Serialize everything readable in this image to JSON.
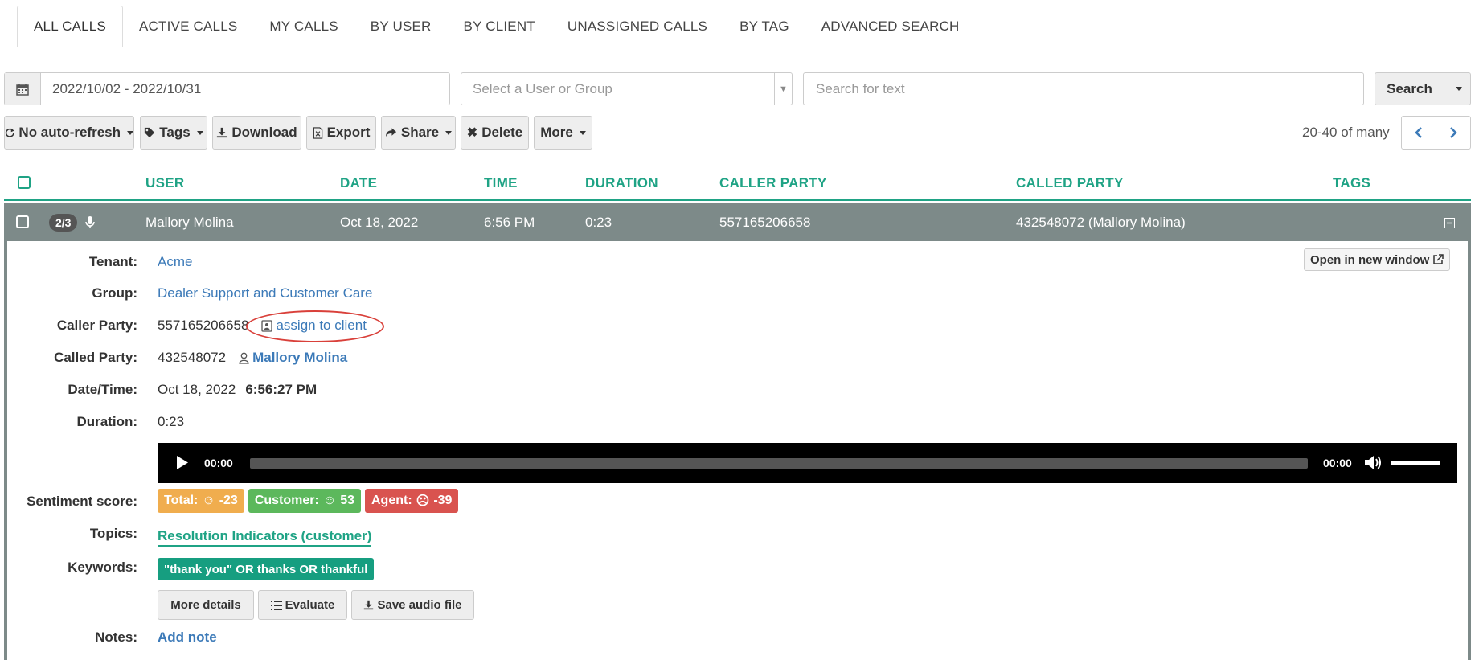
{
  "tabs": [
    "ALL CALLS",
    "ACTIVE CALLS",
    "MY CALLS",
    "BY USER",
    "BY CLIENT",
    "UNASSIGNED CALLS",
    "BY TAG",
    "ADVANCED SEARCH"
  ],
  "filters": {
    "date_range": "2022/10/02 - 2022/10/31",
    "user_placeholder": "Select a User or Group",
    "search_placeholder": "Search for text",
    "search_label": "Search"
  },
  "toolbar": {
    "refresh": "No auto-refresh",
    "tags": "Tags",
    "download": "Download",
    "export": "Export",
    "share": "Share",
    "delete": "Delete",
    "more": "More",
    "pager_text": "20-40 of many"
  },
  "table": {
    "headers": [
      "USER",
      "DATE",
      "TIME",
      "DURATION",
      "CALLER PARTY",
      "CALLED PARTY",
      "TAGS"
    ],
    "row": {
      "badge": "2/3",
      "user": "Mallory Molina",
      "date": "Oct 18, 2022",
      "time": "6:56 PM",
      "duration": "0:23",
      "caller": "557165206658",
      "called": "432548072 (Mallory Molina)"
    }
  },
  "detail": {
    "open_window": "Open in new window",
    "labels": {
      "tenant": "Tenant:",
      "group": "Group:",
      "caller": "Caller Party:",
      "called": "Called Party:",
      "datetime": "Date/Time:",
      "duration": "Duration:",
      "sentiment": "Sentiment score:",
      "topics": "Topics:",
      "keywords": "Keywords:",
      "notes": "Notes:"
    },
    "tenant": "Acme",
    "group": "Dealer Support and Customer Care",
    "caller_number": "557165206658",
    "assign_client": "assign to client",
    "called_number": "432548072",
    "called_user": "Mallory Molina",
    "date": "Oct 18, 2022",
    "time": "6:56:27 PM",
    "duration": "0:23",
    "player": {
      "current": "00:00",
      "total": "00:00"
    },
    "sentiment": {
      "total_label": "Total:",
      "total_value": "-23",
      "customer_label": "Customer:",
      "customer_value": "53",
      "agent_label": "Agent:",
      "agent_value": "-39"
    },
    "topic": "Resolution Indicators (customer)",
    "keyword": "\"thank you\" OR thanks OR thankful",
    "buttons": {
      "details": "More details",
      "evaluate": "Evaluate",
      "save_audio": "Save audio file"
    },
    "add_note": "Add note"
  },
  "colors": {
    "accent": "#1fa385",
    "row_selected": "#7d8a89",
    "link": "#3c7ab8",
    "highlight_ellipse": "#d9403a"
  }
}
